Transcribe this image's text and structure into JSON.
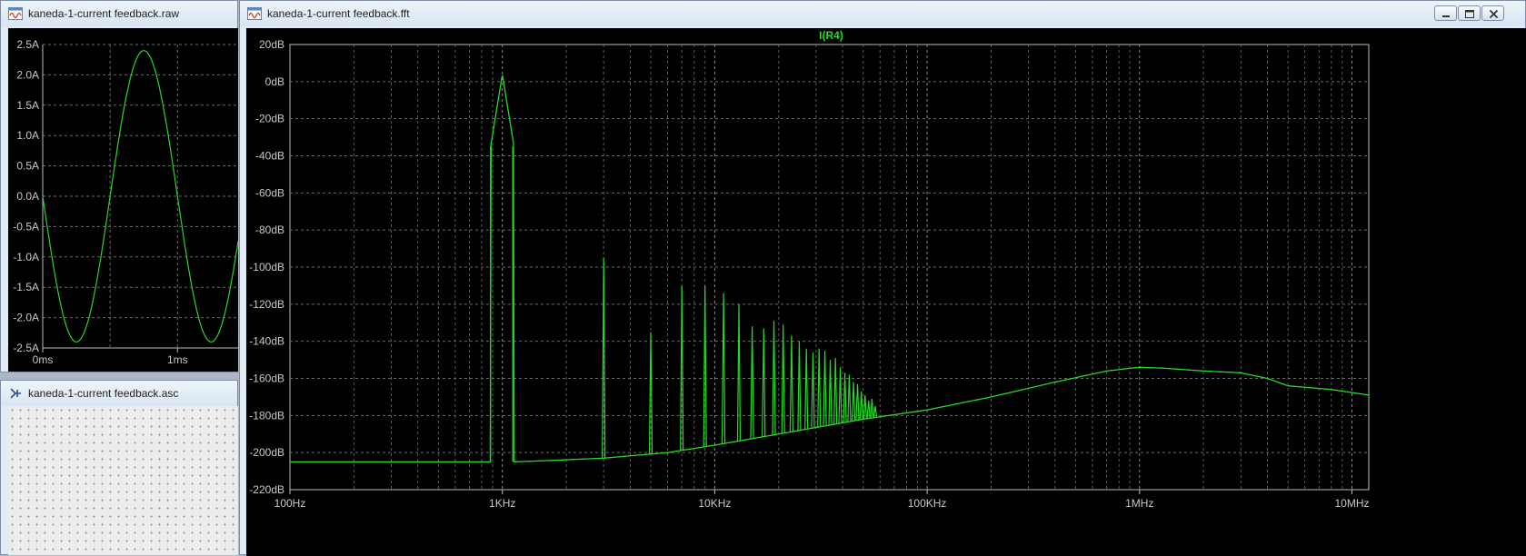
{
  "raw_window": {
    "title": "kaneda-1-current feedback.raw",
    "icon": "waveform-window-icon"
  },
  "asc_window": {
    "title": "kaneda-1-current feedback.asc",
    "icon": "schematic-window-icon"
  },
  "fft_window": {
    "title": "kaneda-1-current feedback.fft",
    "icon": "waveform-window-icon",
    "controls": [
      "minimize",
      "maximize",
      "close"
    ]
  },
  "chart_data": [
    {
      "type": "line",
      "title": "",
      "xlabel": "",
      "ylabel": "",
      "xlim_ms": [
        0,
        1.45
      ],
      "ylim": [
        -2.5,
        2.5
      ],
      "y_ticks": [
        "2.5A",
        "2.0A",
        "1.5A",
        "1.0A",
        "0.5A",
        "0.0A",
        "-0.5A",
        "-1.0A",
        "-1.5A",
        "-2.0A",
        "-2.5A"
      ],
      "x_ticks": [
        "0ms",
        "1ms"
      ],
      "grid": true,
      "color": "#29d629",
      "series": [
        {
          "x_ms": [
            0,
            0.1,
            0.2,
            0.27,
            0.35,
            0.45,
            0.55,
            0.65,
            0.75,
            0.85,
            0.95,
            1.05,
            1.15,
            1.27,
            1.35,
            1.45
          ],
          "y": [
            0,
            -1.44,
            -2.33,
            -2.4,
            -2.0,
            -1.03,
            0.18,
            1.38,
            2.22,
            2.35,
            1.82,
            0.75,
            -0.49,
            -2.4,
            -2.15,
            -1.0
          ]
        }
      ]
    },
    {
      "type": "line",
      "title": "I(R4)",
      "xlabel": "",
      "ylabel": "",
      "xscale": "log",
      "xlim": [
        100,
        12000000
      ],
      "ylim": [
        -220,
        20
      ],
      "y_ticks": [
        "20dB",
        "0dB",
        "-20dB",
        "-40dB",
        "-60dB",
        "-80dB",
        "-100dB",
        "-120dB",
        "-140dB",
        "-160dB",
        "-180dB",
        "-200dB",
        "-220dB"
      ],
      "x_ticks": [
        "100Hz",
        "1KHz",
        "10KHz",
        "100KHz",
        "1MHz",
        "10MHz"
      ],
      "grid": true,
      "color": "#29d629",
      "series": [
        {
          "name": "I(R4)",
          "floor": {
            "freq": [
              100,
              900,
              1120,
              1500,
              3000,
              6000,
              10000,
              20000,
              50000,
              100000,
              200000,
              400000,
              700000,
              1000000,
              1300000,
              2000000,
              3000000,
              4000000,
              5000000,
              8000000,
              12000000
            ],
            "db": [
              -205,
              -205,
              -205,
              -204.5,
              -203,
              -200,
              -196,
              -190,
              -182,
              -177,
              -170,
              -162,
              -156,
              -154,
              -154.5,
              -156,
              -157,
              -160,
              -164,
              -166,
              -169
            ]
          },
          "fundamental": {
            "freq": 1000,
            "db": 4
          },
          "harmonics": {
            "freq": [
              3000,
              5000,
              7000,
              9000,
              11000,
              13000,
              15000,
              17000,
              19000,
              21000,
              23000,
              25000,
              27000,
              29000,
              31000,
              33000,
              35000,
              37000,
              39000,
              41000,
              43000,
              45000,
              47000,
              49000,
              51000,
              53000,
              55000,
              57000
            ],
            "db": [
              -95,
              -135,
              -110,
              -110,
              -114,
              -120,
              -132,
              -133,
              -129,
              -131,
              -137,
              -140,
              -144,
              -146,
              -144,
              -145,
              -150,
              -149,
              -154,
              -157,
              -158,
              -162,
              -163,
              -167,
              -169,
              -172,
              -171,
              -175
            ]
          }
        }
      ]
    }
  ]
}
